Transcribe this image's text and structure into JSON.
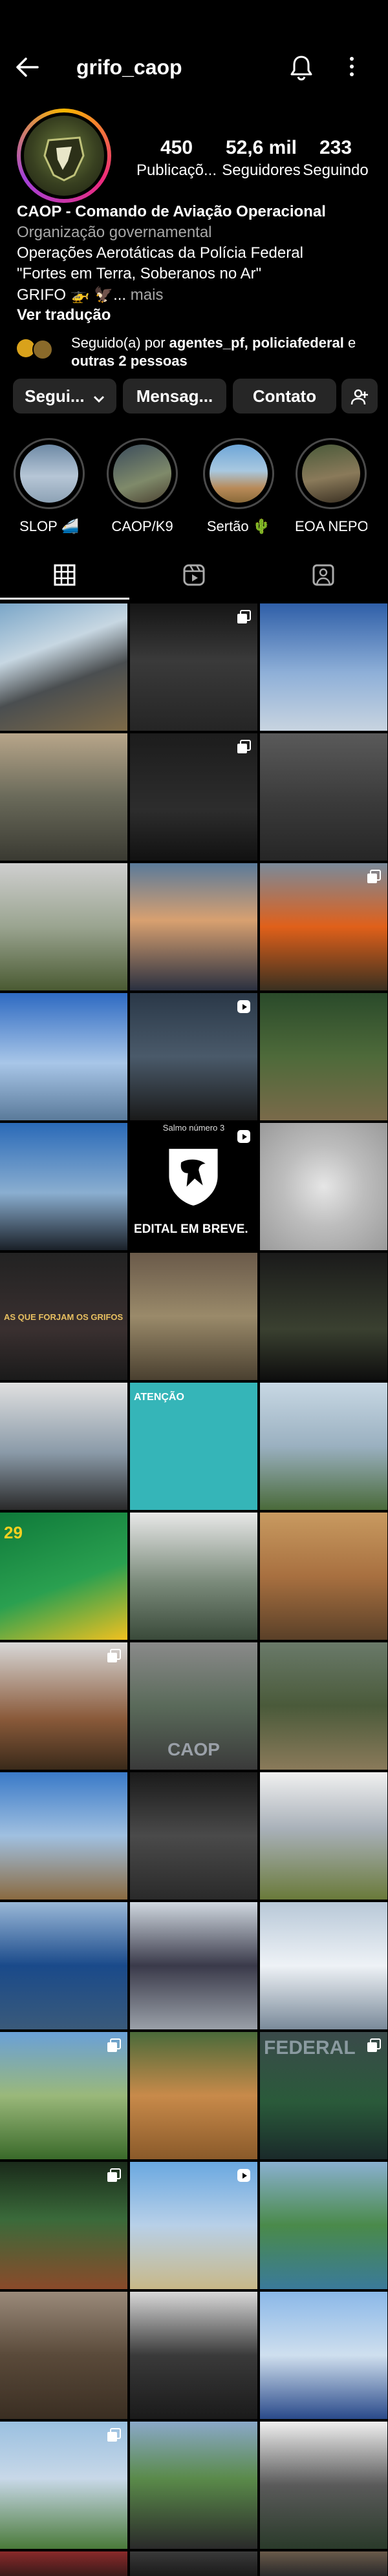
{
  "header": {
    "username": "grifo_caop",
    "back_icon": "arrow-left-icon",
    "bell_icon": "bell-icon",
    "menu_icon": "more-vertical-icon"
  },
  "stats": [
    {
      "num": "450",
      "label": "Publicaçõ..."
    },
    {
      "num": "52,6 mil",
      "label": "Seguidores"
    },
    {
      "num": "233",
      "label": "Seguindo"
    }
  ],
  "bio": {
    "name": "CAOP - Comando de Aviação Operacional",
    "category": "Organização governamental",
    "line1": "Operações Aerotáticas da Polícia Federal",
    "line2": "\"Fortes em Terra, Soberanos no Ar\"",
    "line3": "GRIFO 🚁 🦅... ",
    "more": "mais",
    "translate": "Ver tradução"
  },
  "followed_by": {
    "prefix": "Seguido(a) por ",
    "names": "agentes_pf, policiafederal",
    "middle": " e ",
    "others": "outras 2 pessoas"
  },
  "buttons": {
    "following": "Segui...",
    "message": "Mensag...",
    "contact": "Contato",
    "add_user_icon": "add-user-icon"
  },
  "highlights": [
    {
      "label": "SLOP 🚄"
    },
    {
      "label": "CAOP/K9"
    },
    {
      "label": "Sertão 🌵"
    },
    {
      "label": "EOA NEPOM/..."
    }
  ],
  "tabs": [
    {
      "name": "grid",
      "icon": "grid-icon"
    },
    {
      "name": "reels",
      "icon": "reels-icon"
    },
    {
      "name": "tagged",
      "icon": "tagged-icon"
    }
  ],
  "post_texts": {
    "edital": "EDITAL EM BREVE.",
    "salmo": "Salmo número 3",
    "atencao": "ATENÇÃO",
    "grifos": "AS QUE FORJAM OS GRIFOS",
    "date29": "29",
    "caop": "CAOP",
    "federal": "FEDERAL"
  }
}
